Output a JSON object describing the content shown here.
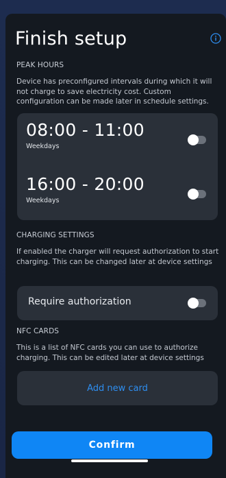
{
  "header": {
    "title": "Finish setup",
    "info_icon": "info-icon"
  },
  "peak_hours": {
    "label": "PEAK HOURS",
    "description": "Device has preconfigured intervals during which it will not charge to save electricity cost. Custom configuration can be made later in schedule settings.",
    "intervals": [
      {
        "time": "08:00 - 11:00",
        "days": "Weekdays",
        "enabled": false
      },
      {
        "time": "16:00 - 20:00",
        "days": "Weekdays",
        "enabled": false
      }
    ]
  },
  "charging_settings": {
    "label": "CHARGING SETTINGS",
    "description": "If enabled the charger will request authorization to start charging. This can be changed later at device settings",
    "require_authorization_label": "Require authorization",
    "require_authorization": false
  },
  "nfc_cards": {
    "label": "NFC CARDS",
    "description": "This is a list of NFC cards you can use to authorize charging. This can be edited later at device settings",
    "add_card_label": "Add new card"
  },
  "footer": {
    "confirm_label": "Confirm"
  },
  "colors": {
    "accent": "#0f86f5",
    "link": "#2e8ef0",
    "card_bg": "#2a3039",
    "panel_bg": "#141920"
  }
}
